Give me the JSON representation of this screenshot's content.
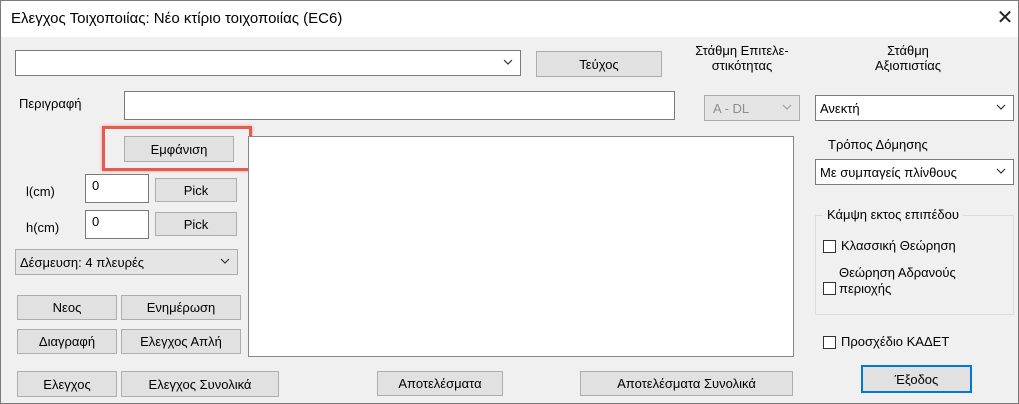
{
  "window": {
    "title": "Ελεγχος Τοιχοποιίας: Νέο κτίριο τοιχοποιίας (EC6)",
    "close_glyph": "✕"
  },
  "top": {
    "project_combo_value": "",
    "teuxos_label": "Τεύχος",
    "stathmi_epitelestikotitas_label_1": "Στάθμη Επιτελε-",
    "stathmi_epitelestikotitas_label_2": "στικότητας",
    "stathmi_axiopistias_label_1": "Στάθμη",
    "stathmi_axiopistias_label_2": "Αξιοπιστίας",
    "performance_level_value": "A - DL",
    "reliability_level_value": "Ανεκτή"
  },
  "description": {
    "label": "Περιγραφή",
    "value": ""
  },
  "left": {
    "show_label": "Εμφάνιση",
    "l_label": "l(cm)",
    "l_value": "0",
    "h_label": "h(cm)",
    "h_value": "0",
    "pick_label": "Pick",
    "constraint_value": "Δέσμευση: 4 πλευρές",
    "new_label": "Νεος",
    "update_label": "Ενημέρωση",
    "delete_label": "Διαγραφή",
    "check_simple_label": "Ελεγχος Απλή",
    "check_label": "Ελεγχος",
    "check_total_label": "Ελεγχος Συνολικά"
  },
  "bottom": {
    "results_label": "Αποτελέσματα",
    "results_total_label": "Αποτελέσματα Συνολικά"
  },
  "right": {
    "construction_method_label": "Τρόπος Δόμησης",
    "construction_method_value": "Με συμπαγείς πλίνθους",
    "bending_group_label": "Κάμψη εκτος επιπέδου",
    "classic_label": "Κλασσική Θεώρηση",
    "inert_label_1": "Θεώρηση Αδρανούς",
    "inert_label_2": "περιοχής",
    "kadet_label": "Προσχέδιο ΚΑΔΕΤ",
    "exit_label": "Έξοδος"
  },
  "colors": {
    "highlight": "#e85a4f",
    "default_button_border": "#0078d7"
  }
}
